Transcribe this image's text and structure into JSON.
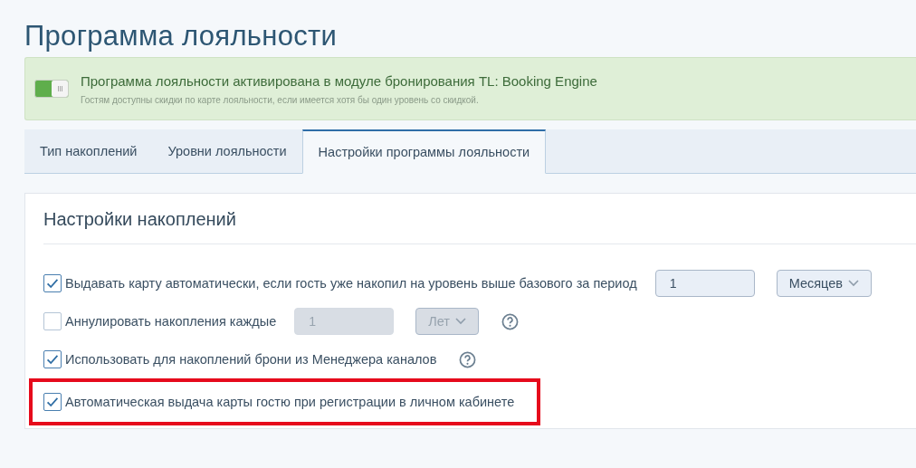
{
  "page_title": "Программа лояльности",
  "banner": {
    "switch_on": true,
    "title": "Программа лояльности активирована в модуле бронирования TL: Booking Engine",
    "subtitle": "Гостям доступны скидки по карте лояльности, если имеется хотя бы один уровень со скидкой."
  },
  "tabs": [
    {
      "label": "Тип накоплений",
      "selected": false
    },
    {
      "label": "Уровни лояльности",
      "selected": false
    },
    {
      "label": "Настройки программы лояльности",
      "selected": true
    }
  ],
  "section": {
    "title": "Настройки накоплений",
    "rows": [
      {
        "checked": true,
        "label": "Выдавать карту автоматически, если гость уже накопил на уровень выше базового за период",
        "field": {
          "value": "1",
          "disabled": false
        },
        "select": {
          "label": "Месяцев",
          "disabled": false
        },
        "help": false,
        "highlighted": false
      },
      {
        "checked": false,
        "label": "Аннулировать накопления каждые",
        "field": {
          "value": "1",
          "disabled": true
        },
        "select": {
          "label": "Лет",
          "disabled": true
        },
        "help": true,
        "highlighted": false
      },
      {
        "checked": true,
        "label": "Использовать для накоплений брони из Менеджера каналов",
        "help": true,
        "highlighted": false
      },
      {
        "checked": true,
        "label": "Автоматическая выдача карты гостю при регистрации в личном кабинете",
        "help": false,
        "highlighted": true
      }
    ]
  }
}
